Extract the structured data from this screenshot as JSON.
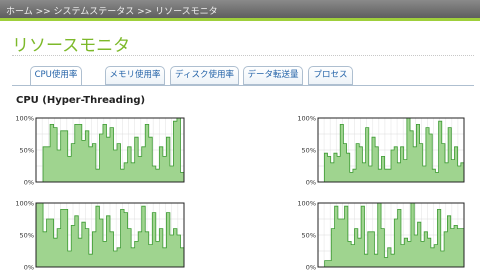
{
  "header": {
    "breadcrumb": "ホーム >> システムステータス >> リソースモニタ",
    "accent_color": "#9fcf3b"
  },
  "page": {
    "title": "リソースモニタ",
    "title_color": "#7db92a"
  },
  "tabs": [
    {
      "label": "CPU使用率",
      "active": true
    },
    {
      "label": "メモリ使用率",
      "active": false
    },
    {
      "label": "ディスク使用率",
      "active": false
    },
    {
      "label": "データ転送量",
      "active": false
    },
    {
      "label": "プロセス",
      "active": false
    }
  ],
  "section": {
    "title": "CPU (Hyper-Threading)"
  },
  "chart_data": [
    {
      "type": "area",
      "ylim": [
        0,
        100
      ],
      "yticks": [
        "100%",
        "50%",
        "0%"
      ],
      "color": "#9fd48f",
      "values": [
        0,
        0,
        55,
        55,
        90,
        85,
        50,
        80,
        80,
        40,
        60,
        90,
        90,
        65,
        80,
        55,
        60,
        20,
        75,
        90,
        70,
        85,
        50,
        60,
        20,
        30,
        55,
        30,
        70,
        40,
        55,
        90,
        70,
        25,
        20,
        55,
        40,
        70,
        25,
        95,
        100,
        15
      ]
    },
    {
      "type": "area",
      "ylim": [
        0,
        100
      ],
      "yticks": [
        "100%",
        "50%",
        "0%"
      ],
      "color": "#9fd48f",
      "values": [
        0,
        0,
        45,
        40,
        30,
        45,
        40,
        90,
        60,
        45,
        15,
        20,
        60,
        55,
        30,
        85,
        25,
        70,
        55,
        20,
        40,
        20,
        20,
        50,
        55,
        30,
        55,
        35,
        100,
        80,
        55,
        90,
        60,
        25,
        85,
        75,
        20,
        15,
        95,
        60,
        30,
        85,
        35,
        55,
        25,
        30
      ]
    },
    {
      "type": "area",
      "ylim": [
        0,
        100
      ],
      "yticks": [
        "100%",
        "50%",
        "0%"
      ],
      "color": "#9fd48f",
      "values": [
        100,
        100,
        55,
        75,
        75,
        45,
        60,
        90,
        90,
        25,
        65,
        80,
        45,
        70,
        60,
        20,
        55,
        95,
        75,
        40,
        80,
        55,
        25,
        30,
        90,
        85,
        60,
        30,
        40,
        55,
        95,
        55,
        35,
        85,
        40,
        60,
        30,
        85,
        50,
        60,
        50,
        30
      ]
    },
    {
      "type": "area",
      "ylim": [
        0,
        100
      ],
      "yticks": [
        "100%",
        "50%",
        "0%"
      ],
      "color": "#9fd48f",
      "values": [
        0,
        0,
        10,
        10,
        60,
        95,
        75,
        75,
        95,
        40,
        35,
        60,
        45,
        95,
        20,
        55,
        55,
        20,
        100,
        60,
        15,
        30,
        20,
        75,
        90,
        35,
        45,
        40,
        100,
        50,
        70,
        40,
        55,
        45,
        30,
        35,
        90,
        25,
        55,
        80,
        60,
        65,
        60,
        60
      ]
    }
  ]
}
